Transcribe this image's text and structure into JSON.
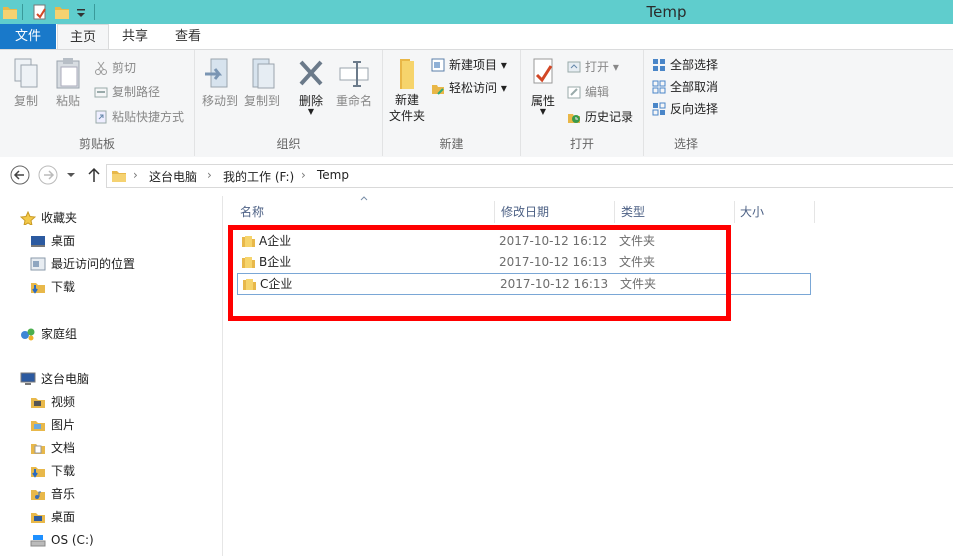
{
  "window": {
    "title": "Temp"
  },
  "tabs": [
    {
      "label": "文件"
    },
    {
      "label": "主页"
    },
    {
      "label": "共享"
    },
    {
      "label": "查看"
    }
  ],
  "ribbon": {
    "clipboard": {
      "copy": "复制",
      "paste": "粘贴",
      "cut": "剪切",
      "copy_path": "复制路径",
      "paste_shortcut": "粘贴快捷方式",
      "label": "剪贴板"
    },
    "organize": {
      "move_to": "移动到",
      "copy_to": "复制到",
      "delete": "删除",
      "rename": "重命名",
      "label": "组织"
    },
    "new": {
      "new_folder": "新建\n文件夹",
      "new_item": "新建项目",
      "easy_access": "轻松访问",
      "label": "新建"
    },
    "open": {
      "properties": "属性",
      "open": "打开",
      "edit": "编辑",
      "history": "历史记录",
      "label": "打开"
    },
    "select": {
      "select_all": "全部选择",
      "select_none": "全部取消",
      "invert": "反向选择",
      "label": "选择"
    }
  },
  "address": {
    "crumbs": [
      "这台电脑",
      "我的工作 (F:)",
      "Temp"
    ]
  },
  "nav": {
    "favorites": "收藏夹",
    "fav_items": [
      "桌面",
      "最近访问的位置",
      "下载"
    ],
    "homegroup": "家庭组",
    "this_pc": "这台电脑",
    "pc_items": [
      "视频",
      "图片",
      "文档",
      "下载",
      "音乐",
      "桌面",
      "OS (C:)"
    ]
  },
  "columns": {
    "name": "名称",
    "date": "修改日期",
    "type": "类型",
    "size": "大小"
  },
  "files": [
    {
      "name": "A企业",
      "date": "2017-10-12 16:12",
      "type": "文件夹"
    },
    {
      "name": "B企业",
      "date": "2017-10-12 16:13",
      "type": "文件夹"
    },
    {
      "name": "C企业",
      "date": "2017-10-12 16:13",
      "type": "文件夹"
    }
  ],
  "colors": {
    "titlebar": "#5fcdcd",
    "file_tab": "#1979ca",
    "highlight": "#ff0000",
    "selection": "#7aa7d6"
  }
}
